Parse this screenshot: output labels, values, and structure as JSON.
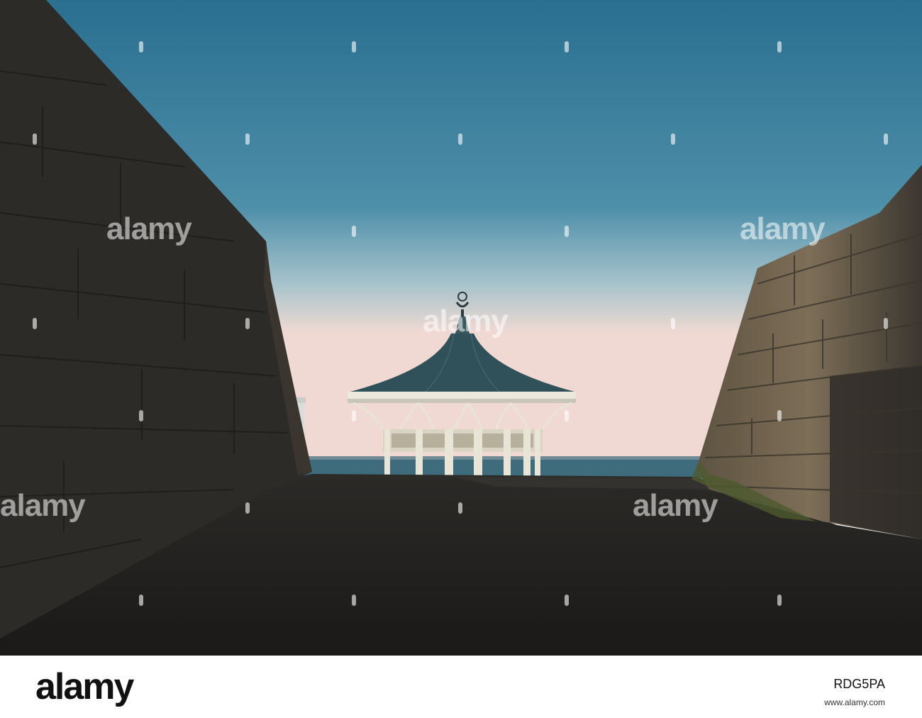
{
  "photo": {
    "sky_top": "#2f7494",
    "sky_horizon": "#efd6cf",
    "sea": "#3d6a7a",
    "wall": "#2d2b28",
    "wall_lit": "#6e604d",
    "path": "#23221f",
    "bandstand_roof": "#31515a",
    "bandstand_iron": "#e8e4d6"
  },
  "watermark": {
    "text": "alamy"
  },
  "footer": {
    "logo": "alamy",
    "image_id": "RDG5PA",
    "caption": "www.alamy.com"
  }
}
